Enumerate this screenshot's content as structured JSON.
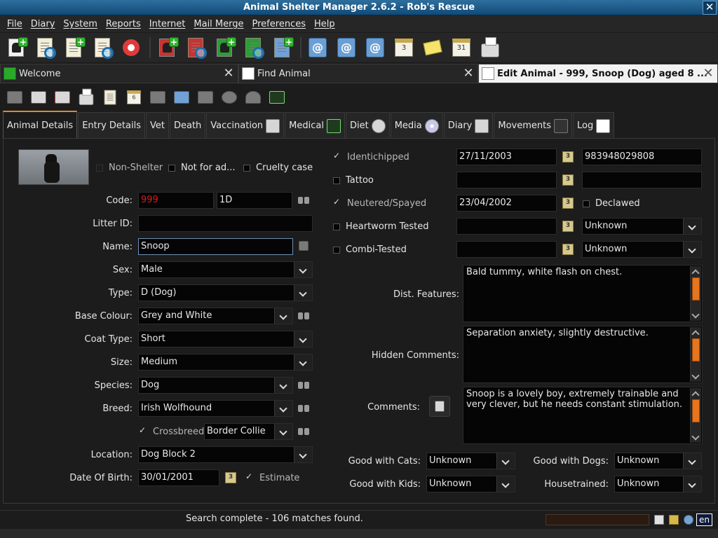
{
  "window": {
    "title": "Animal Shelter Manager 2.6.2 - Rob's Rescue"
  },
  "menu": [
    "File",
    "Diary",
    "System",
    "Reports",
    "Internet",
    "Mail Merge",
    "Preferences",
    "Help"
  ],
  "main_toolbar": [
    "new-animal-icon",
    "find-animal-icon",
    "new-person-icon",
    "find-person-icon",
    "help-lifering-icon",
    "lost-animal-icon",
    "found-animal-icon",
    "new-waiting-list-icon",
    "waiting-list-icon",
    "movement-icon",
    "email-icon",
    "email-icon",
    "email-icon",
    "diary-icon",
    "notes-icon",
    "calendar-icon",
    "print-icon"
  ],
  "tabs": [
    {
      "label": "Welcome",
      "active": false
    },
    {
      "label": "Find Animal",
      "active": false
    },
    {
      "label": "Edit Animal - 999, Snoop (Dog) aged 8 ...",
      "active": true
    }
  ],
  "animal_toolbar": [
    "save-icon",
    "clone-icon",
    "delete-icon",
    "print-icon",
    "document-icon",
    "date-icon",
    "media-icon",
    "diagnose-icon",
    "folder-icon",
    "settings-icon",
    "people-icon",
    "chart-icon"
  ],
  "subtabs": [
    {
      "label": "Animal Details",
      "active": true,
      "icon": ""
    },
    {
      "label": "Entry Details",
      "active": false,
      "icon": ""
    },
    {
      "label": "Vet",
      "active": false,
      "icon": ""
    },
    {
      "label": "Death",
      "active": false,
      "icon": ""
    },
    {
      "label": "Vaccination",
      "active": false,
      "icon": "vaccination-icon"
    },
    {
      "label": "Medical",
      "active": false,
      "icon": "medical-icon"
    },
    {
      "label": "Diet",
      "active": false,
      "icon": "diet-icon"
    },
    {
      "label": "Media",
      "active": false,
      "icon": "media-icon"
    },
    {
      "label": "Diary",
      "active": false,
      "icon": "diary-icon"
    },
    {
      "label": "Movements",
      "active": false,
      "icon": "movements-icon"
    },
    {
      "label": "Log",
      "active": false,
      "icon": "log-icon"
    }
  ],
  "flags": {
    "non_shelter": "Non-Shelter",
    "not_for_adoption": "Not for ad...",
    "cruelty_case": "Cruelty case"
  },
  "form": {
    "code_label": "Code:",
    "code": "999",
    "code2": "1D",
    "litter_label": "Litter ID:",
    "litter": "",
    "name_label": "Name:",
    "name": "Snoop",
    "sex_label": "Sex:",
    "sex": "Male",
    "type_label": "Type:",
    "type": "D (Dog)",
    "base_colour_label": "Base Colour:",
    "base_colour": "Grey and White",
    "coat_label": "Coat Type:",
    "coat": "Short",
    "size_label": "Size:",
    "size": "Medium",
    "species_label": "Species:",
    "species": "Dog",
    "breed_label": "Breed:",
    "breed": "Irish Wolfhound",
    "crossbreed_label": "Crossbreed",
    "crossbreed": "Border Collie",
    "location_label": "Location:",
    "location": "Dog Block 2",
    "dob_label": "Date Of Birth:",
    "dob": "30/01/2001",
    "estimate_label": "Estimate"
  },
  "health": {
    "identichipped_label": "Identichipped",
    "identichip_date": "27/11/2003",
    "identichip_number": "983948029808",
    "tattoo_label": "Tattoo",
    "tattoo_date": "",
    "tattoo_number": "",
    "neutered_label": "Neutered/Spayed",
    "neutered_date": "23/04/2002",
    "declawed_label": "Declawed",
    "heartworm_label": "Heartworm Tested",
    "heartworm_date": "",
    "heartworm_result": "Unknown",
    "combi_label": "Combi-Tested",
    "combi_date": "",
    "combi_result": "Unknown"
  },
  "notes": {
    "dist_label": "Dist. Features:",
    "dist": "Bald tummy, white flash on chest.",
    "hidden_label": "Hidden Comments:",
    "hidden": "Separation anxiety, slightly destructive.",
    "comments_label": "Comments:",
    "comments": "Snoop is a lovely boy, extremely trainable and very clever, but he needs constant stimulation."
  },
  "good_with": {
    "cats_label": "Good with Cats:",
    "cats": "Unknown",
    "dogs_label": "Good with Dogs:",
    "dogs": "Unknown",
    "kids_label": "Good with Kids:",
    "kids": "Unknown",
    "house_label": "Housetrained:",
    "house": "Unknown"
  },
  "status": {
    "text": "Search complete - 106 matches found.",
    "lang": "en"
  },
  "colors": {
    "accent": "#e8741c",
    "titlebar": "#1f5a87",
    "code_text": "#e01818"
  }
}
